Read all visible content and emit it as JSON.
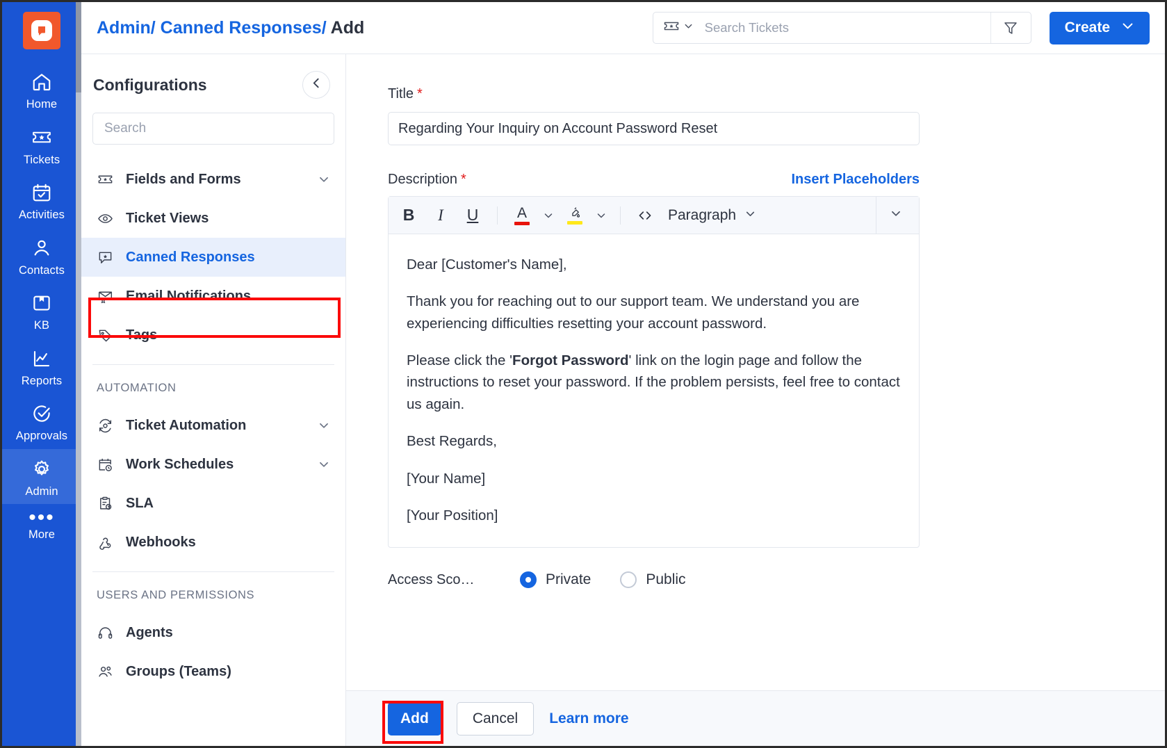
{
  "rail": {
    "logo_icon": "app-logo-icon",
    "items": [
      {
        "label": "Home",
        "icon": "home-icon",
        "active": false
      },
      {
        "label": "Tickets",
        "icon": "ticket-icon",
        "active": false
      },
      {
        "label": "Activities",
        "icon": "calendar-check-icon",
        "active": false
      },
      {
        "label": "Contacts",
        "icon": "person-icon",
        "active": false
      },
      {
        "label": "KB",
        "icon": "book-icon",
        "active": false
      },
      {
        "label": "Reports",
        "icon": "chart-line-icon",
        "active": false
      },
      {
        "label": "Approvals",
        "icon": "check-circle-icon",
        "active": false
      },
      {
        "label": "Admin",
        "icon": "gear-icon",
        "active": true
      }
    ],
    "more_label": "More"
  },
  "topbar": {
    "breadcrumb": {
      "admin": "Admin",
      "sep1": "/",
      "section": " Canned Responses",
      "sep2": "/",
      "current": " Add"
    },
    "search": {
      "placeholder": "Search Tickets",
      "value": "",
      "type_icon": "ticket-icon",
      "filter_icon": "filter-icon"
    },
    "create_label": "Create"
  },
  "configurations": {
    "title": "Configurations",
    "collapse_icon": "chevron-left-icon",
    "search_placeholder": "Search",
    "search_value": "",
    "items": [
      {
        "label": "Fields and Forms",
        "icon": "ticket-icon",
        "expandable": true,
        "selected": false
      },
      {
        "label": "Ticket Views",
        "icon": "eye-icon",
        "expandable": false,
        "selected": false
      },
      {
        "label": "Canned Responses",
        "icon": "chat-star-icon",
        "expandable": false,
        "selected": true
      },
      {
        "label": "Email Notifications",
        "icon": "mail-bell-icon",
        "expandable": false,
        "selected": false
      },
      {
        "label": "Tags",
        "icon": "tag-icon",
        "expandable": false,
        "selected": false
      }
    ],
    "section_automation": "AUTOMATION",
    "automation_items": [
      {
        "label": "Ticket Automation",
        "icon": "automation-icon",
        "expandable": true,
        "selected": false
      },
      {
        "label": "Work Schedules",
        "icon": "calendar-clock-icon",
        "expandable": true,
        "selected": false
      },
      {
        "label": "SLA",
        "icon": "clipboard-clock-icon",
        "expandable": false,
        "selected": false
      },
      {
        "label": "Webhooks",
        "icon": "webhook-icon",
        "expandable": false,
        "selected": false
      }
    ],
    "section_users": "USERS AND PERMISSIONS",
    "users_items": [
      {
        "label": "Agents",
        "icon": "headset-icon",
        "expandable": false,
        "selected": false
      },
      {
        "label": "Groups (Teams)",
        "icon": "people-icon",
        "expandable": false,
        "selected": false
      }
    ]
  },
  "form": {
    "title_label": "Title",
    "required_mark": "*",
    "title_value": "Regarding Your Inquiry on Account Password Reset",
    "description_label": "Description",
    "insert_placeholders": "Insert Placeholders",
    "toolbar": {
      "bold": "B",
      "italic": "I",
      "underline": "U",
      "text_color_icon": "text-color-icon",
      "text_color_hex": "#e8140c",
      "highlight_icon": "highlight-color-icon",
      "highlight_hex": "#ffe81a",
      "code_icon": "code-icon",
      "paragraph_label": "Paragraph",
      "overflow_icon": "chevron-down-icon"
    },
    "body": {
      "p1": "Dear [Customer's Name],",
      "p2": "Thank you for reaching out to our support team. We understand you are experiencing difficulties resetting your account password.",
      "p3_before": "Please click the '",
      "p3_bold": "Forgot Password",
      "p3_after": "' link on the login page and follow the instructions to reset your password. If the problem persists, feel free to contact us again.",
      "p4": "Best Regards,",
      "p5": "[Your Name]",
      "p6": "[Your Position]"
    },
    "access_scope_label": "Access Sco…",
    "access_options": [
      {
        "label": "Private",
        "checked": true
      },
      {
        "label": "Public",
        "checked": false
      }
    ]
  },
  "footer": {
    "add_label": "Add",
    "cancel_label": "Cancel",
    "learn_more_label": "Learn more"
  },
  "colors": {
    "brand_blue": "#1565e0",
    "rail_blue": "#1a55d4",
    "logo_orange": "#f1582c",
    "highlight_red": "#fb0a0a",
    "selected_bg": "#e8effc"
  }
}
